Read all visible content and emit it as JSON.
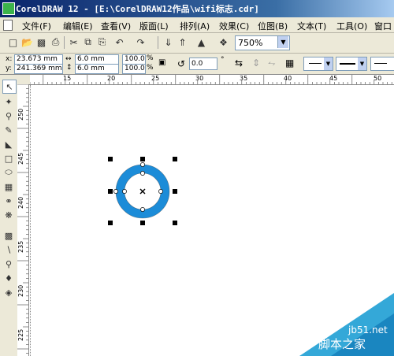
{
  "window": {
    "title": "CorelDRAW 12 - [E:\\CorelDRAW12作品\\wifi标志.cdr]"
  },
  "menu": {
    "items": [
      "文件(F)",
      "编辑(E)",
      "查看(V)",
      "版面(L)",
      "排列(A)",
      "效果(C)",
      "位图(B)",
      "文本(T)",
      "工具(O)",
      "窗口"
    ]
  },
  "toolbar": {
    "buttons": [
      "new-icon",
      "open-icon",
      "save-icon",
      "print-icon",
      "cut-icon",
      "copy-icon",
      "paste-icon",
      "undo-icon",
      "redo-icon",
      "import-icon",
      "export-icon",
      "launcher-icon",
      "snap-icon"
    ],
    "zoom": "750%"
  },
  "properties": {
    "x": "23.673 mm",
    "y": "241.369 mm",
    "width": "6.0 mm",
    "height": "6.0 mm",
    "scale_x": "100.0",
    "scale_y": "100.0",
    "percent": "%",
    "rotation": "0.0",
    "degree": "°",
    "x_label": "x:",
    "y_label": "y:"
  },
  "rulers": {
    "top": [
      "15",
      "20",
      "25",
      "30",
      "35",
      "40",
      "45",
      "50"
    ],
    "left": [
      "250",
      "245",
      "240",
      "235",
      "230",
      "225"
    ]
  },
  "shape": {
    "ring_color": "#1c8cd8"
  },
  "watermark": {
    "url": "jb51.net",
    "brand": "脚本之家"
  }
}
